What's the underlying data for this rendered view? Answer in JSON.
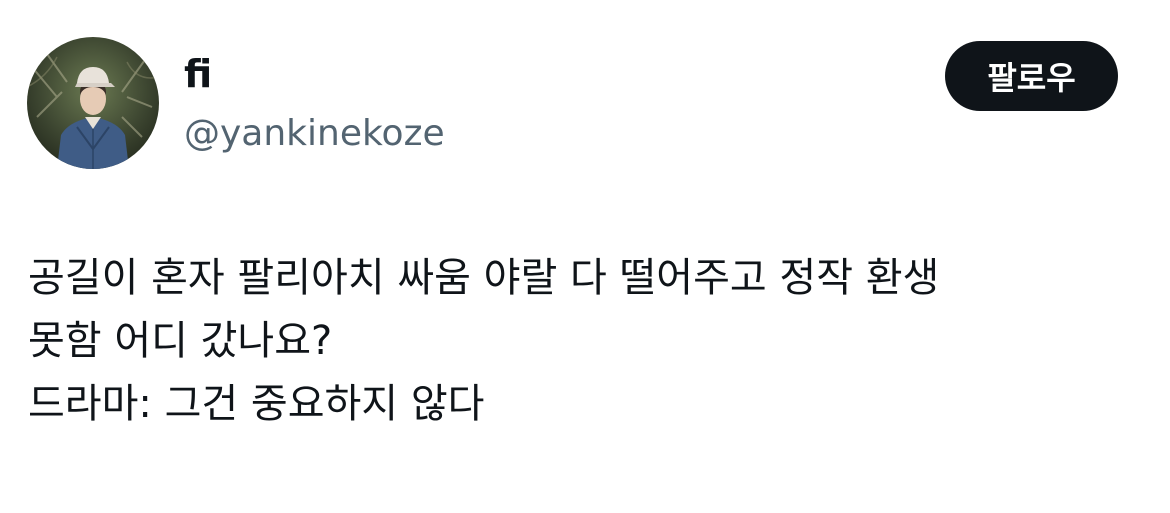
{
  "author": {
    "display_name": "fi",
    "handle": "@yankinekoze"
  },
  "actions": {
    "follow_label": "팔로우"
  },
  "tweet": {
    "lines": [
      "공길이 혼자 팔리아치 싸움 야랄 다 떨어주고 정작 환생",
      "못함 어디 갔나요?",
      "드라마: 그건 중요하지 않다"
    ]
  },
  "colors": {
    "text": "#0f1419",
    "secondary_text": "#536471",
    "button_bg": "#0f1419",
    "button_text": "#ffffff",
    "background": "#ffffff"
  },
  "icons": {
    "avatar": "profile-photo"
  }
}
